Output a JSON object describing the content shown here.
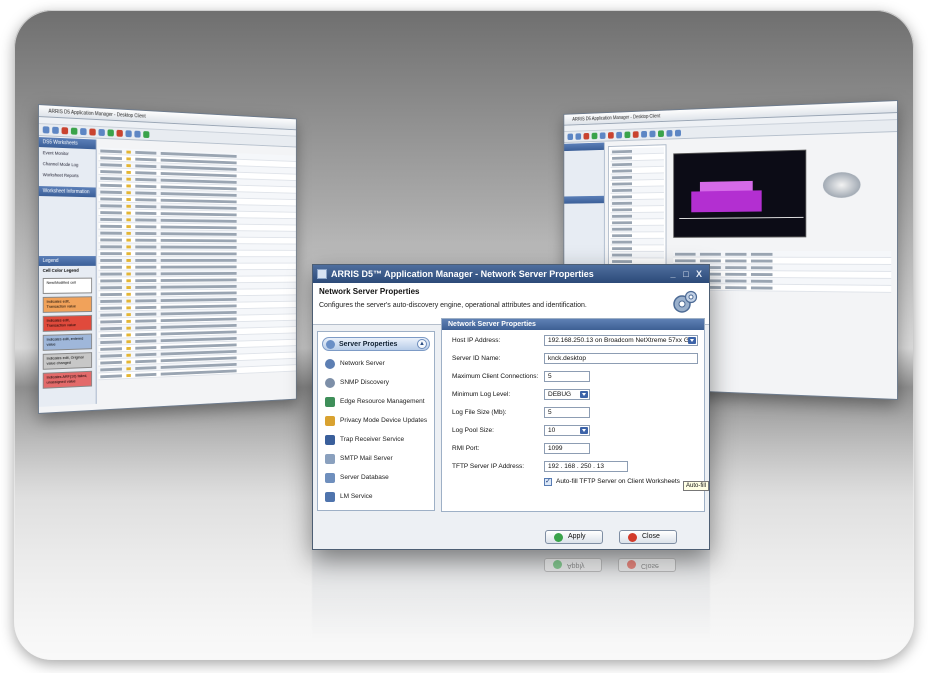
{
  "left_window": {
    "title": "ARRIS D5 Application Manager - Desktop Client",
    "sidebar_header": "DS5 Worksheets",
    "sidebar_items": [
      "Event Monitor",
      "Channel Mode Log",
      "Worksheet Reports"
    ],
    "information_header": "Worksheet Information",
    "legend_header": "Legend",
    "legend_title": "Cell Color Legend",
    "legend_items": [
      "New/Modified cell",
      "Indicates edit, Transaction value",
      "Indicates edit, Transaction value",
      "Indicates edit, entered value",
      "Indicates edit, Original value changed",
      "Indicates ARF(10) failed, unassigned value"
    ]
  },
  "right_window": {
    "title": "ARRIS D5 Application Manager - Desktop Client"
  },
  "dialog": {
    "title": "ARRIS D5™ Application Manager - Network Server Properties",
    "header_title": "Network Server Properties",
    "header_description": "Configures the server's auto-discovery engine, operational attributes and identification.",
    "nav_header": "Server Properties",
    "nav_toggle": "▲",
    "nav_items": [
      {
        "label": "Network Server",
        "icon": "network-server-icon",
        "color": "#5d7fb3"
      },
      {
        "label": "SNMP Discovery",
        "icon": "snmp-discovery-icon",
        "color": "#7d8fa8"
      },
      {
        "label": "Edge Resource Management",
        "icon": "edge-resource-icon",
        "color": "#3f8f5a"
      },
      {
        "label": "Privacy Mode Device Updates",
        "icon": "privacy-mode-icon",
        "color": "#d9a230"
      },
      {
        "label": "Trap Receiver Service",
        "icon": "trap-receiver-icon",
        "color": "#3a5f9b"
      },
      {
        "label": "SMTP Mail Server",
        "icon": "smtp-mail-icon",
        "color": "#8aa0be"
      },
      {
        "label": "Server Database",
        "icon": "server-database-icon",
        "color": "#6f8fbd"
      },
      {
        "label": "LM Service",
        "icon": "lm-service-icon",
        "color": "#4f74ad"
      }
    ],
    "panel_header": "Network Server Properties",
    "fields": {
      "host_ip_label": "Host IP Address:",
      "host_ip_value": "192.168.250.13 on Broadcom NetXtreme 57xx Gi...",
      "server_id_label": "Server ID Name:",
      "server_id_value": "knck.desktop",
      "max_clients_label": "Maximum Client Connections:",
      "max_clients_value": "5",
      "min_log_label": "Minimum Log Level:",
      "min_log_value": "DEBUG",
      "log_file_label": "Log File Size (Mb):",
      "log_file_value": "5",
      "log_pool_label": "Log Pool Size:",
      "log_pool_value": "10",
      "rmi_label": "RMI Port:",
      "rmi_value": "1099",
      "tftp_label": "TFTP Server IP Address:",
      "tftp_value": "192 . 168 . 250 . 13"
    },
    "autofill_label": "Auto-fill TFTP Server on Client Worksheets",
    "autofill_checked": true,
    "tooltip": "Auto-fill",
    "apply_label": "Apply",
    "close_label": "Close",
    "check_mark": "✓",
    "min_glyph": "_",
    "max_glyph": "□",
    "close_glyph": "X"
  },
  "colors": {
    "title_bar": "#2c4a78",
    "panel_header": "#3d5f93",
    "apply_icon": "#3aa34a",
    "close_icon": "#d23a2a"
  }
}
